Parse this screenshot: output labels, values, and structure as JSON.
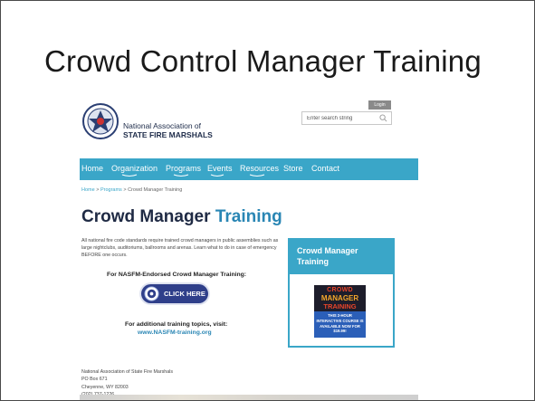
{
  "slide": {
    "title": "Crowd Control Manager Training"
  },
  "header": {
    "logo_line1": "National Association of",
    "logo_line2": "STATE FIRE MARSHALS",
    "login_label": "Login",
    "search_placeholder": "Enter search string"
  },
  "nav": {
    "items": [
      "Home",
      "Organization",
      "Programs",
      "Events",
      "Resources",
      "Store",
      "Contact"
    ]
  },
  "breadcrumb": {
    "items": [
      "Home",
      "Programs",
      "Crowd Manager Training"
    ],
    "separator": ">"
  },
  "main": {
    "title_part1": "Crowd Manager",
    "title_part2": "Training",
    "intro": "All national fire code standards require trained crowd managers in public assemblies such as large nightclubs, auditoriums, ballrooms and arenas.  Learn what to do in case of emergency BEFORE one occurs.",
    "endorsed_heading": "For NASFM-Endorsed Crowd Manager Training:",
    "click_button": "CLICK HERE",
    "additional_heading": "For additional training topics, visit:",
    "additional_link": "www.NASFM-training.org"
  },
  "sidebar": {
    "title": "Crowd Manager Training",
    "promo_line1": "CROWD",
    "promo_line2": "MANAGER",
    "promo_line3": "TRAINING",
    "promo_body": "THIS 2-HOUR INTERACTIVE COURSE IS AVAILABLE NOW FOR $19.99!"
  },
  "footer": {
    "lines": [
      "National Association of State Fire Marshals",
      "PO Box 671",
      "Cheyenne, WY 82003",
      "(202) 737-1226"
    ]
  },
  "colors": {
    "nav_bg": "#3aa6c8",
    "title_accent": "#2a86b4",
    "button_bg": "#2f3f8a",
    "logo_text": "#1e2c4a"
  }
}
